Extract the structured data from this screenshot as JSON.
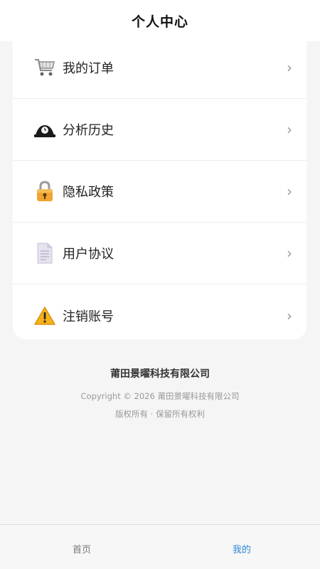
{
  "header": {
    "title": "个人中心"
  },
  "menu": [
    {
      "label": "我的订单",
      "icon": "shopping-cart-icon"
    },
    {
      "label": "分析历史",
      "icon": "history-icon"
    },
    {
      "label": "隐私政策",
      "icon": "lock-icon"
    },
    {
      "label": "用户协议",
      "icon": "document-icon"
    },
    {
      "label": "注销账号",
      "icon": "warning-icon"
    }
  ],
  "footer": {
    "company": "莆田景曜科技有限公司",
    "copyright": "Copyright © 2026 莆田景曜科技有限公司",
    "rights": "版权所有 · 保留所有权利"
  },
  "tabbar": {
    "home": "首页",
    "mine": "我的",
    "active_color": "#2d86d6"
  }
}
